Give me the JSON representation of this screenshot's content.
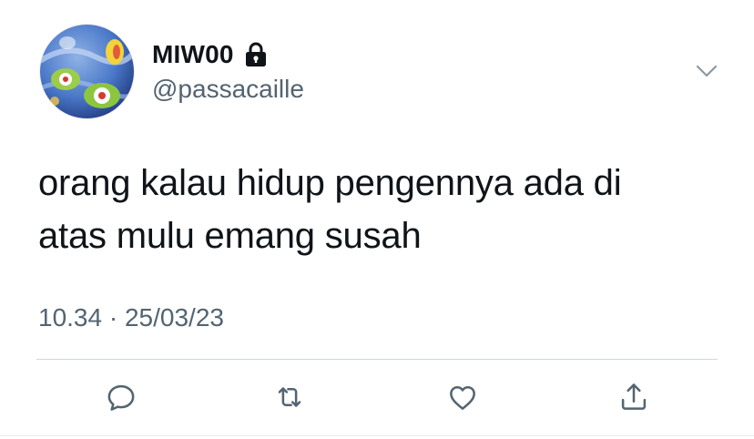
{
  "user": {
    "display_name": "MIW00",
    "handle": "@passacaille",
    "avatar_icon": "avatar",
    "protected_icon": "lock-icon"
  },
  "tweet": {
    "text": "orang kalau hidup pengennya ada di\natas mulu emang susah",
    "time": "10.34",
    "separator": "·",
    "date": "25/03/23"
  },
  "actions": [
    {
      "icon": "reply-icon"
    },
    {
      "icon": "retweet-icon"
    },
    {
      "icon": "like-icon"
    },
    {
      "icon": "share-icon"
    }
  ],
  "colors": {
    "primary_text": "#0f1419",
    "secondary_text": "#536471",
    "icon_gray": "#536471",
    "divider": "#cfd9de"
  }
}
